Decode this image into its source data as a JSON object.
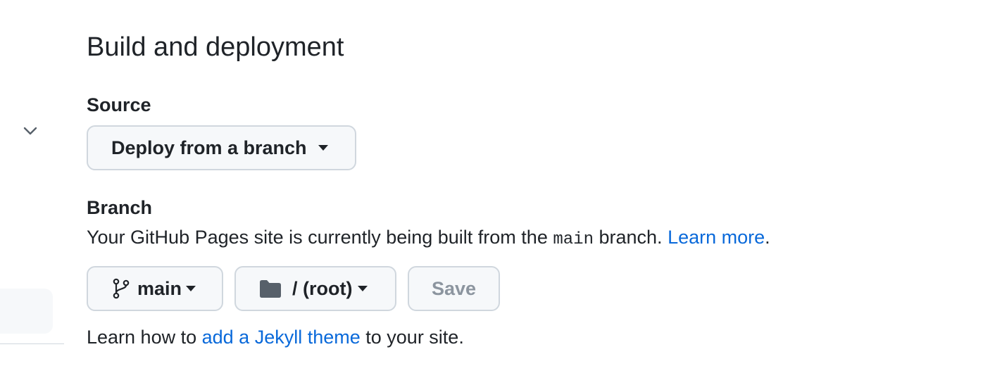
{
  "section": {
    "title": "Build and deployment"
  },
  "source": {
    "label": "Source",
    "dropdown_value": "Deploy from a branch"
  },
  "branch": {
    "label": "Branch",
    "description_prefix": "Your GitHub Pages site is currently being built from the",
    "branch_code": "main",
    "description_suffix": "branch.",
    "learn_more_link": "Learn more",
    "period": ".",
    "branch_selector_value": "main",
    "folder_selector_value": "/ (root)",
    "save_label": "Save"
  },
  "jekyll": {
    "prefix": "Learn how to",
    "link": "add a Jekyll theme",
    "suffix": "to your site."
  },
  "icons": {
    "sidebar_toggle": "chevron-down-icon",
    "branch": "git-branch-icon",
    "folder": "folder-icon",
    "dropdown": "triangle-down-icon"
  },
  "colors": {
    "text": "#1f2328",
    "link": "#0969da",
    "button_bg": "#f6f8fa",
    "button_border": "#d0d7de",
    "disabled_text": "#8c959f",
    "folder_icon": "#57606a"
  }
}
